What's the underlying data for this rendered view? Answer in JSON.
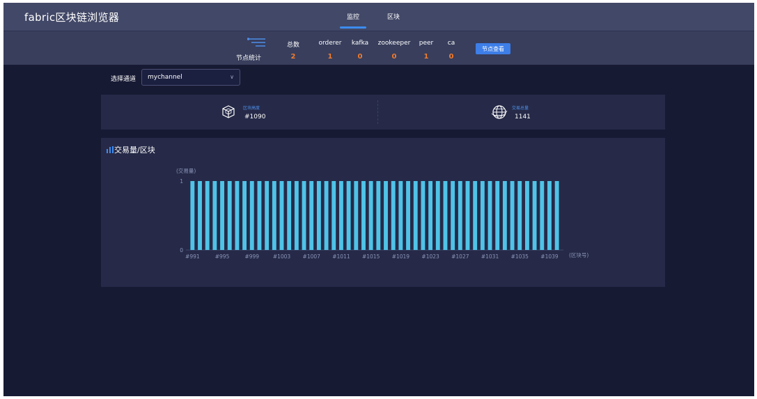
{
  "header": {
    "title": "fabric区块链浏览器",
    "tabs": [
      {
        "label": "监控",
        "active": true
      },
      {
        "label": "区块",
        "active": false
      }
    ]
  },
  "stats": {
    "row_label": "节点统计",
    "columns": [
      {
        "header": "总数",
        "value": "2"
      },
      {
        "header": "orderer",
        "value": "1"
      },
      {
        "header": "kafka",
        "value": "0"
      },
      {
        "header": "zookeeper",
        "value": "0"
      },
      {
        "header": "peer",
        "value": "1"
      },
      {
        "header": "ca",
        "value": "0"
      }
    ],
    "button_label": "节点查看"
  },
  "channel": {
    "label": "选择通道",
    "selected": "mychannel"
  },
  "info": {
    "block_height_label": "区块高度",
    "block_height": "#1090",
    "tx_total_label": "交易总量",
    "tx_total": "1141"
  },
  "chart_title": "交易量/区块",
  "colors": {
    "accent": "#3d8cf0",
    "bar": "#4fc3e8",
    "stat_value": "#f17b2c",
    "background": "#171a33",
    "card": "#262a48"
  },
  "chart_data": {
    "type": "bar",
    "ylabel": "(交易量)",
    "xlabel": "(区块号)",
    "ylim": [
      0,
      1
    ],
    "yticks": [
      0,
      1
    ],
    "categories": [
      "#991",
      "#992",
      "#993",
      "#994",
      "#995",
      "#996",
      "#997",
      "#998",
      "#999",
      "#1000",
      "#1001",
      "#1002",
      "#1003",
      "#1004",
      "#1005",
      "#1006",
      "#1007",
      "#1008",
      "#1009",
      "#1010",
      "#1011",
      "#1012",
      "#1013",
      "#1014",
      "#1015",
      "#1016",
      "#1017",
      "#1018",
      "#1019",
      "#1020",
      "#1021",
      "#1022",
      "#1023",
      "#1024",
      "#1025",
      "#1026",
      "#1027",
      "#1028",
      "#1029",
      "#1030",
      "#1031",
      "#1032",
      "#1033",
      "#1034",
      "#1035",
      "#1036",
      "#1037",
      "#1038",
      "#1039",
      "#1040"
    ],
    "tick_labels": [
      "#991",
      "#995",
      "#999",
      "#1003",
      "#1007",
      "#1011",
      "#1015",
      "#1019",
      "#1023",
      "#1027",
      "#1031",
      "#1035",
      "#1039"
    ],
    "values": [
      1,
      1,
      1,
      1,
      1,
      1,
      1,
      1,
      1,
      1,
      1,
      1,
      1,
      1,
      1,
      1,
      1,
      1,
      1,
      1,
      1,
      1,
      1,
      1,
      1,
      1,
      1,
      1,
      1,
      1,
      1,
      1,
      1,
      1,
      1,
      1,
      1,
      1,
      1,
      1,
      1,
      1,
      1,
      1,
      1,
      1,
      1,
      1,
      1,
      1
    ]
  }
}
